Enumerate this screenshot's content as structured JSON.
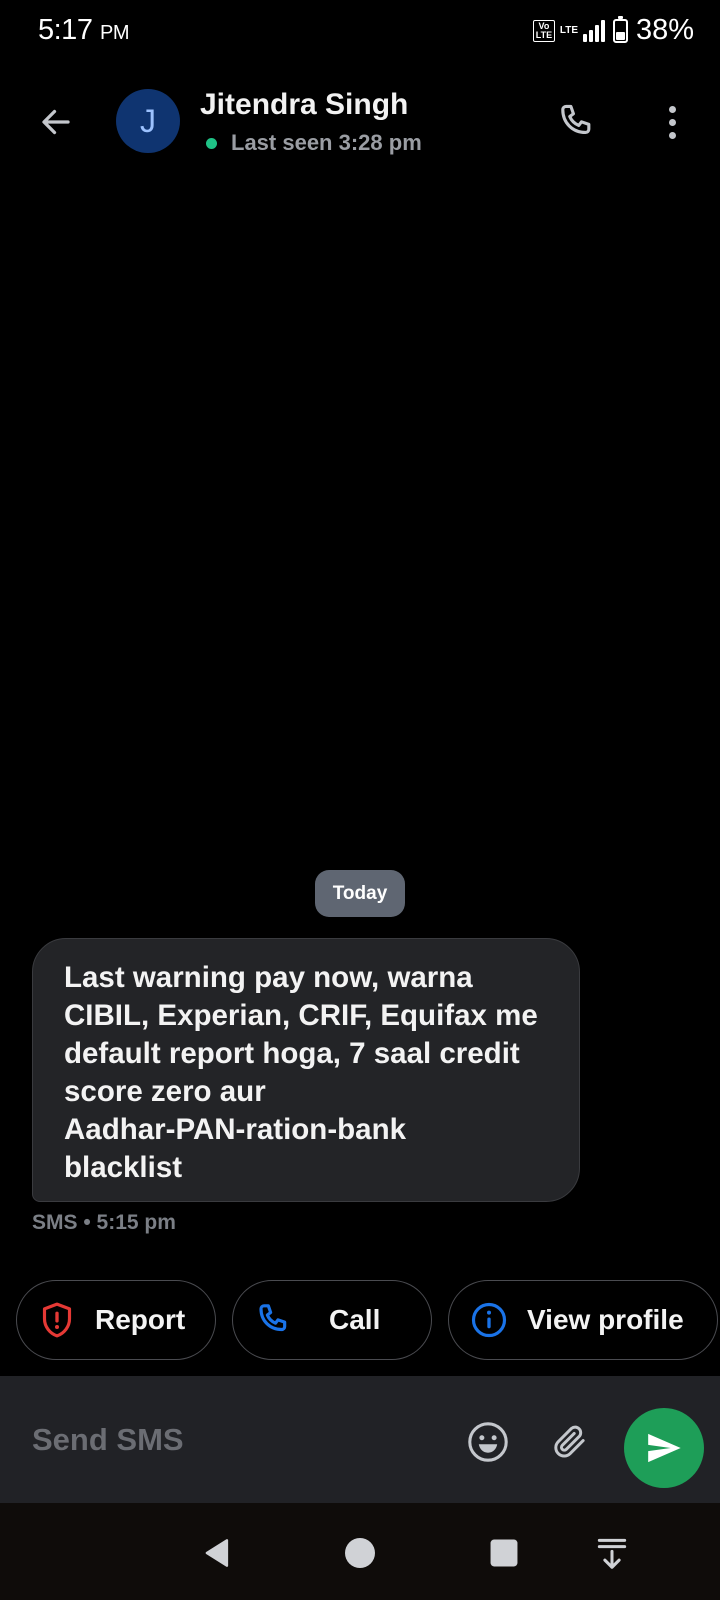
{
  "status_bar": {
    "time": "5:17",
    "ampm": "PM",
    "volte": "Vo LTE",
    "lte": "LTE",
    "battery": "38%",
    "battery_level": 0.38
  },
  "header": {
    "avatar_initial": "J",
    "contact_name": "Jitendra Singh",
    "last_seen": "Last seen 3:28 pm"
  },
  "conversation": {
    "date_chip": "Today",
    "message": {
      "text": "Last warning pay now, warna\nCIBIL, Experian, CRIF, Equifax me\ndefault report hoga, 7 saal credit\nscore zero aur\nAadhar-PAN-ration-bank\nblacklist",
      "meta": "SMS • 5:15 pm"
    }
  },
  "actions": {
    "report_label": "Report",
    "call_label": "Call",
    "profile_label": "View profile"
  },
  "composer": {
    "placeholder": "Send SMS",
    "value": ""
  },
  "colors": {
    "report_icon": "#e53935",
    "info_icon": "#1a73e8",
    "send_button": "#1e9e58",
    "avatar_bg": "#0f3470",
    "online_dot": "#1fc286"
  }
}
